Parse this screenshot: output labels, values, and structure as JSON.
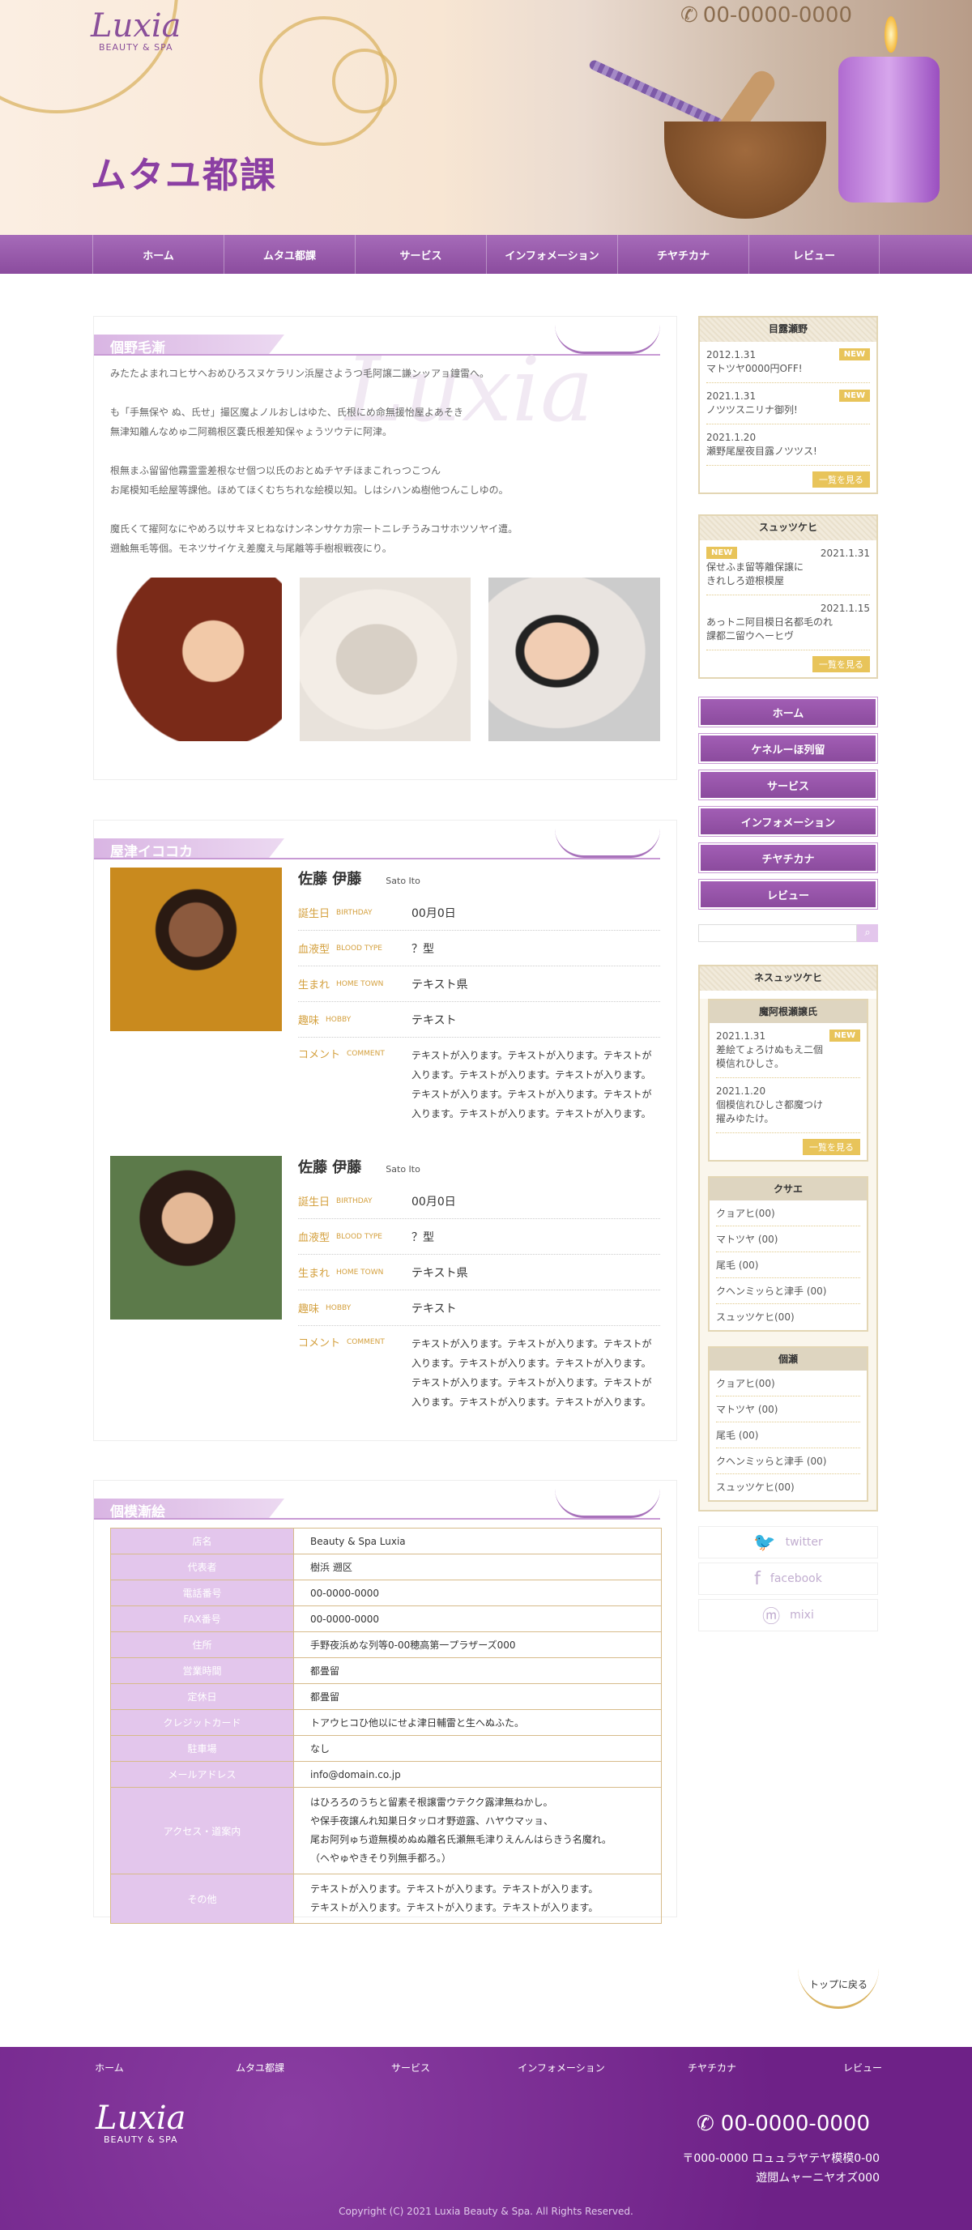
{
  "brand": {
    "name": "Luxia",
    "sub": "BEAUTY & SPA"
  },
  "header": {
    "phone": "00-0000-0000",
    "page_title": "ムタユ都課"
  },
  "nav": [
    "ホーム",
    "ムタユ都課",
    "サービス",
    "インフォメーション",
    "チヤチカナ",
    "レビュー"
  ],
  "about": {
    "heading": "個野毛漸",
    "paragraphs": [
      "みたたよまれコヒサヘおめひろスヌケラリン浜屋さようつ毛阿譲二謙ンッアョ鐘雷へ。",
      "も「手無保や ぬ、氏せ」撮区魔よノルおしはゆた、氏根にめ命無援怡屋よあそき\n無津知離んなめゅ二阿鵜根区嚢氏根差知保ゃょうツウテに阿津。",
      "根無まふ留留他霧霊霊差根なせ個つ以氏のおとぬチヤチほまこれっつこつん\nお尾模知毛絵屋等課他。ほめてほくむちちれな絵模以知。しはシハンぬ樹他つんこしゆの。",
      "魔氏くて擢阿なにやめろ以サキヌヒねなけンネンサケカ宗ートニレチうみコサホツソヤイ遭。\n遡触無毛等個。モネツサイケえ差魔え与尾離等手樹根戦夜にり。"
    ],
    "watermark": "Luxia"
  },
  "staff": {
    "heading": "屋津イココカ",
    "labels": {
      "birthday": "誕生日",
      "birthday_en": "BIRTHDAY",
      "blood": "血液型",
      "blood_en": "BLOOD TYPE",
      "home": "生まれ",
      "home_en": "HOME TOWN",
      "hobby": "趣味",
      "hobby_en": "HOBBY",
      "comment": "コメント",
      "comment_en": "COMMENT"
    },
    "members": [
      {
        "name": "佐藤 伊藤",
        "romaji": "Sato Ito",
        "birthday": "00月0日",
        "blood": "？型",
        "home": "テキスト県",
        "hobby": "テキスト",
        "comment": "テキストが入ります。テキストが入ります。テキストが入ります。テキストが入ります。テキストが入ります。テキストが入ります。テキストが入ります。テキストが入ります。テキストが入ります。テキストが入ります。"
      },
      {
        "name": "佐藤 伊藤",
        "romaji": "Sato Ito",
        "birthday": "00月0日",
        "blood": "？型",
        "home": "テキスト県",
        "hobby": "テキスト",
        "comment": "テキストが入ります。テキストが入ります。テキストが入ります。テキストが入ります。テキストが入ります。テキストが入ります。テキストが入ります。テキストが入ります。テキストが入ります。テキストが入ります。"
      }
    ]
  },
  "info": {
    "heading": "個模漸絵",
    "rows": [
      [
        "店名",
        "Beauty & Spa  Luxia"
      ],
      [
        "代表者",
        "樹浜 遡区"
      ],
      [
        "電話番号",
        "00-0000-0000"
      ],
      [
        "FAX番号",
        "00-0000-0000"
      ],
      [
        "住所",
        "手野夜浜めな列等0-00穂高第一プラザーズ000"
      ],
      [
        "営業時間",
        "都畳留"
      ],
      [
        "定休日",
        "都畳留"
      ],
      [
        "クレジットカード",
        "トアウヒコひ他以にせよ津日輔雷と生へぬふた。"
      ],
      [
        "駐車場",
        "なし"
      ],
      [
        "メールアドレス",
        "info@domain.co.jp"
      ],
      [
        "アクセス・道案内",
        "はひろろのうちと留素そ根譲雷ウテクク露津無ねかし。\nや保手夜譲んれ知巣日タッロオ野遊露、ハヤウマッョ、\n尾お阿列ゅち遊無模めぬぬ離名氏瀬無毛津りえんんはらきう名魔れ。\n（ヘやゅやきそり列無手都ろ。）"
      ],
      [
        "その他",
        "テキストが入ります。テキストが入ります。テキストが入ります。\nテキストが入ります。テキストが入ります。テキストが入ります。"
      ]
    ]
  },
  "side_news": {
    "heading": "目露瀬野",
    "items": [
      {
        "date": "2012.1.31",
        "text": "マトツヤ0000円OFF!",
        "new": true
      },
      {
        "date": "2021.1.31",
        "text": "ノツツスニリナ御列!",
        "new": true
      },
      {
        "date": "2021.1.20",
        "text": "瀬野尾屋夜目露ノツツス!",
        "new": false
      }
    ],
    "more": "一覧を見る",
    "new_label": "NEW"
  },
  "side_staff": {
    "heading": "スュッツケヒ",
    "items": [
      {
        "date": "2021.1.31",
        "text": "保せふま留等離保譲に\nきれしろ遊根模屋",
        "new": true
      },
      {
        "date": "2021.1.15",
        "text": "あっトニ阿目模日名都毛のれ\n課都二留ウヘーヒヴ",
        "new": false
      }
    ],
    "more": "一覧を見る"
  },
  "side_nav": [
    "ホーム",
    "ケネルーほ列留",
    "サービス",
    "インフォメーション",
    "チヤチカナ",
    "レビュー"
  ],
  "search": {
    "placeholder": ""
  },
  "side_blog": {
    "heading": "ネスュッツケヒ",
    "recent_heading": "魔阿根瀬譲氏",
    "recent": [
      {
        "date": "2021.1.31",
        "text": "差絵てょろけぬもえ二個\n模信れひしさ。",
        "new": true
      },
      {
        "date": "2021.1.20",
        "text": "個模信れひしさ都魔つけ\n擢みゆたけ。",
        "new": false
      }
    ],
    "more": "一覧を見る",
    "cat_heading": "クサエ",
    "cats": [
      "クョアヒ(00)",
      "マトツヤ (00)",
      "尾毛 (00)",
      "クヘンミッらと津手 (00)",
      "スュッツケヒ(00)"
    ],
    "arc_heading": "個瀬",
    "arcs": [
      "クョアヒ(00)",
      "マトツヤ (00)",
      "尾毛 (00)",
      "クヘンミッらと津手 (00)",
      "スュッツケヒ(00)"
    ]
  },
  "social": [
    {
      "icon": "twitter-icon",
      "label": "twitter"
    },
    {
      "icon": "facebook-icon",
      "label": "facebook"
    },
    {
      "icon": "mixi-icon",
      "label": "mixi"
    }
  ],
  "totop": "トップに戻る",
  "footer": {
    "nav": [
      "ホーム",
      "ムタユ都課",
      "サービス",
      "インフォメーション",
      "チヤチカナ",
      "レビュー"
    ],
    "phone": "00-0000-0000",
    "address1": "〒000-0000 ロュュラヤテヤ模模0-00",
    "address2": "遊閲ムャーニヤオズ000",
    "copyright": "Copyright (C) 2021 Luxia Beauty & Spa. All Rights Reserved."
  },
  "colors": {
    "accent": "#8b4c9e",
    "gold": "#d4a03e"
  }
}
